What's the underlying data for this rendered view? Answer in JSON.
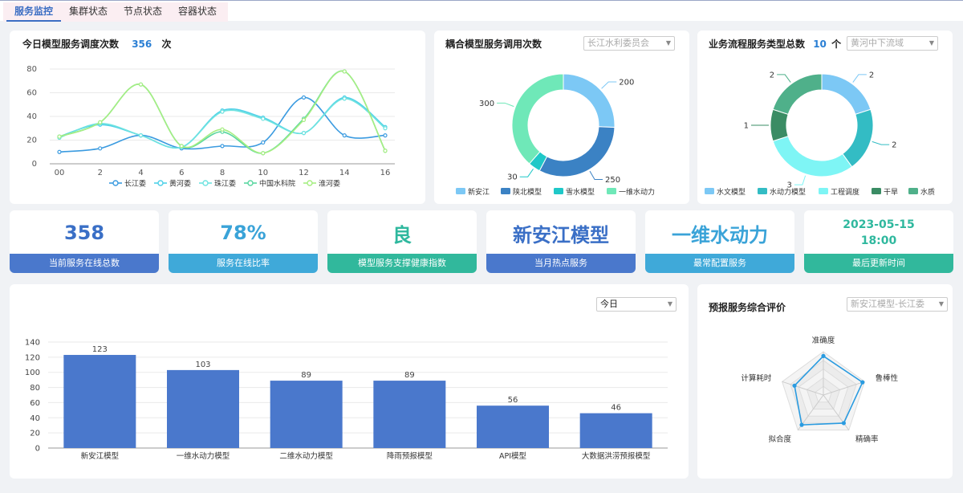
{
  "tabs": [
    "服务监控",
    "集群状态",
    "节点状态",
    "容器状态"
  ],
  "daily": {
    "title": "今日模型服务调度次数",
    "count": "356",
    "unit": "次"
  },
  "coupling": {
    "title": "耦合模型服务调用次数",
    "select": "长江水利委员会"
  },
  "flow": {
    "title": "业务流程服务类型总数",
    "count": "10",
    "unit": "个",
    "select": "黄河中下流域"
  },
  "kpis": [
    {
      "value": "358",
      "label": "当前服务在线总数",
      "color": "#3a6fc6",
      "bar": "#4a78cc"
    },
    {
      "value": "78%",
      "label": "服务在线比率",
      "color": "#3aa3d8",
      "bar": "#3fa9d9"
    },
    {
      "value": "良",
      "label": "模型服务支撑健康指数",
      "color": "#2fb89e",
      "bar": "#31b89c"
    },
    {
      "value": "新安江模型",
      "label": "当月热点服务",
      "color": "#3a6fc6",
      "bar": "#4a78cc"
    },
    {
      "value": "一维水动力",
      "label": "最常配置服务",
      "color": "#3aa3d8",
      "bar": "#3fa9d9"
    },
    {
      "value_line1": "2023-05-15",
      "value_line2": "18:00",
      "label": "最后更新时间",
      "color": "#2fb89e",
      "bar": "#31b89c"
    }
  ],
  "bar_panel": {
    "select": "今日"
  },
  "radar_panel": {
    "title": "预报服务综合评价",
    "select": "新安江模型-长江委"
  },
  "chart_data": [
    {
      "type": "line",
      "x": [
        "00",
        "2",
        "4",
        "6",
        "8",
        "10",
        "12",
        "14",
        "16"
      ],
      "ylim": [
        0,
        80
      ],
      "yticks": [
        0,
        20,
        40,
        60,
        80
      ],
      "series": [
        {
          "name": "长江委",
          "color": "#3b9be0",
          "values": [
            10,
            13,
            24,
            13,
            15,
            18,
            56,
            24,
            24
          ]
        },
        {
          "name": "黄河委",
          "color": "#4fd0e8",
          "values": [
            23,
            33,
            24,
            14,
            45,
            39,
            26,
            56,
            31
          ]
        },
        {
          "name": "珠江委",
          "color": "#6fe3e0",
          "values": [
            22,
            34,
            24,
            14,
            44,
            38,
            26,
            55,
            30
          ]
        },
        {
          "name": "中国水科院",
          "color": "#59d6a0",
          "values": [
            23,
            35,
            67,
            15,
            27,
            9,
            38,
            78,
            11
          ]
        },
        {
          "name": "淮河委",
          "color": "#a6ee82",
          "values": [
            23,
            35,
            67,
            15,
            29,
            9,
            37,
            78,
            11
          ]
        }
      ]
    },
    {
      "type": "pie",
      "categories": [
        "新安江",
        "陕北模型",
        "雪水模型",
        "一维水动力"
      ],
      "values": [
        200,
        250,
        30,
        300
      ],
      "colors": [
        "#7cc8f5",
        "#3b82c4",
        "#1fc8c8",
        "#6fe8b8"
      ]
    },
    {
      "type": "pie",
      "categories": [
        "水文模型",
        "水动力模型",
        "工程调度",
        "干旱",
        "水质"
      ],
      "values": [
        2,
        2,
        3,
        1,
        2
      ],
      "colors": [
        "#7cc8f5",
        "#33bcc4",
        "#7ef5f5",
        "#3a8c64",
        "#4fb08a"
      ]
    },
    {
      "type": "bar",
      "categories": [
        "新安江模型",
        "一维水动力模型",
        "二维水动力模型",
        "降雨预报模型",
        "API模型",
        "大数据洪涝预报模型"
      ],
      "values": [
        123,
        103,
        89,
        89,
        56,
        46
      ],
      "ylim": [
        0,
        140
      ],
      "yticks": [
        0,
        20,
        40,
        60,
        80,
        100,
        120,
        140
      ],
      "color": "#4a78cc"
    },
    {
      "type": "radar",
      "categories": [
        "准确度",
        "鲁棒性",
        "精确率",
        "拟合度",
        "计算耗时"
      ],
      "values": [
        0.9,
        0.95,
        0.8,
        0.85,
        0.7
      ],
      "color": "#2a9be0"
    }
  ]
}
